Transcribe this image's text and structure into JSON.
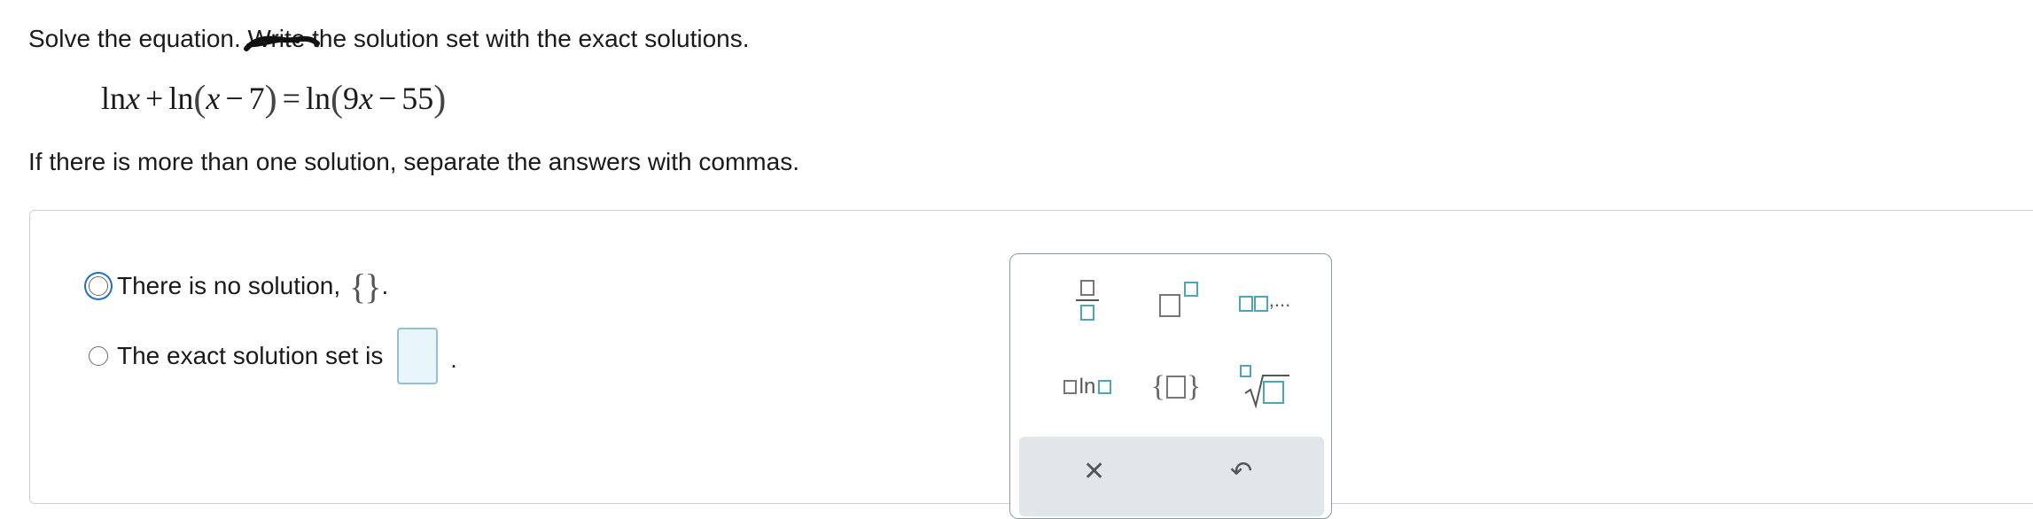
{
  "question": {
    "prompt_before": "Solve the equation.",
    "crossed_out_word": "Write",
    "prompt_after": "the solution set with the exact solutions.",
    "equation": {
      "ln1": "ln",
      "x1": "x",
      "plus": "+",
      "ln2": "ln",
      "x2": "x",
      "minus1": "−",
      "seven": "7",
      "equals": "=",
      "ln3": "ln",
      "nine": "9",
      "x3": "x",
      "minus2": "−",
      "fiftyfive": "55",
      "lparen": "(",
      "rparen": ")"
    },
    "instruction": "If there is more than one solution, separate the answers with commas."
  },
  "options": {
    "no_solution": {
      "label": "There is no solution,",
      "braces": "{}",
      "suffix": "."
    },
    "solution_set": {
      "label": "The exact solution set is",
      "suffix": "."
    }
  },
  "palette": {
    "seq_label": ",...",
    "ln_label": "ln",
    "set_left": "{",
    "set_right": "}",
    "footer_left": "✕",
    "footer_right": "↶"
  },
  "colors": {
    "accent": "#4aa7b5",
    "focus": "#1f6ed4",
    "input_bg": "#e8f5fa"
  }
}
